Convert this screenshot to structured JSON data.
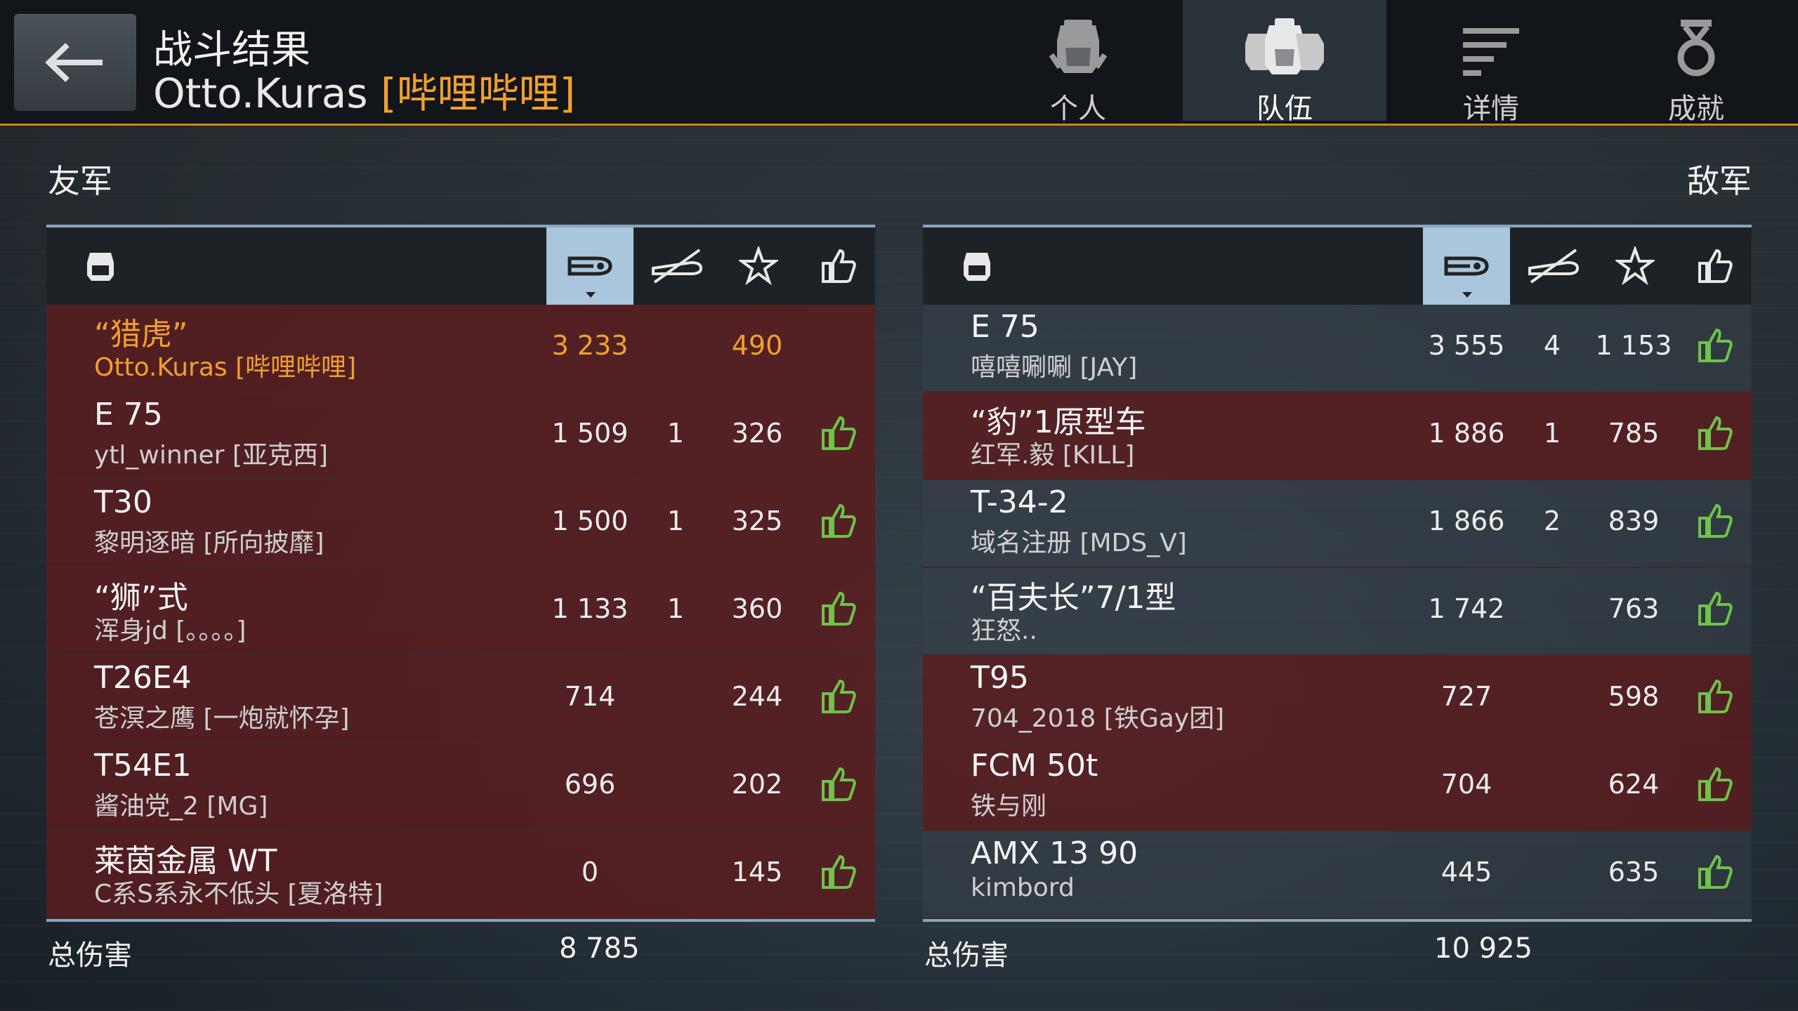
{
  "header": {
    "title": "战斗结果",
    "player_name": "Otto.Kuras",
    "player_clan": "[哔哩哔哩]",
    "tabs": [
      {
        "label": "个人",
        "icon": "tank-crew-icon"
      },
      {
        "label": "队伍",
        "icon": "team-icon"
      },
      {
        "label": "详情",
        "icon": "details-list-icon"
      },
      {
        "label": "成就",
        "icon": "medal-icon"
      }
    ],
    "active_tab": "队伍"
  },
  "allies": {
    "title": "友军",
    "rows": [
      {
        "tank": "“猎虎”",
        "player": "Otto.Kuras [哔哩哔哩]",
        "damage": "3 233",
        "kills": "",
        "xp": "490",
        "liked": false,
        "self": true
      },
      {
        "tank": "E 75",
        "player": "ytl_winner [亚克西]",
        "damage": "1 509",
        "kills": "1",
        "xp": "326",
        "liked": true
      },
      {
        "tank": "T30",
        "player": "黎明逐暗 [所向披靡]",
        "damage": "1 500",
        "kills": "1",
        "xp": "325",
        "liked": true
      },
      {
        "tank": "“狮”式",
        "player": "浑身jd [。。。。]",
        "damage": "1 133",
        "kills": "1",
        "xp": "360",
        "liked": true
      },
      {
        "tank": "T26E4",
        "player": "苍溟之鹰 [一炮就怀孕]",
        "damage": "714",
        "kills": "",
        "xp": "244",
        "liked": true
      },
      {
        "tank": "T54E1",
        "player": "酱油党_2 [MG]",
        "damage": "696",
        "kills": "",
        "xp": "202",
        "liked": true
      },
      {
        "tank": "莱茵金属 WT",
        "player": "C系S系永不低头 [夏洛特]",
        "damage": "0",
        "kills": "",
        "xp": "145",
        "liked": true
      }
    ],
    "total_label": "总伤害",
    "total_damage": "8 785"
  },
  "enemies": {
    "title": "敌军",
    "rows": [
      {
        "tank": "E 75",
        "player": "嘻嘻唰唰 [JAY]",
        "damage": "3 555",
        "kills": "4",
        "xp": "1 153",
        "liked": true,
        "gray": true
      },
      {
        "tank": "“豹”1原型车",
        "player": "红军.毅 [KILL]",
        "damage": "1 886",
        "kills": "1",
        "xp": "785",
        "liked": true
      },
      {
        "tank": "T-34-2",
        "player": "域名注册 [MDS_V]",
        "damage": "1 866",
        "kills": "2",
        "xp": "839",
        "liked": true,
        "gray": true
      },
      {
        "tank": "“百夫长”7/1型",
        "player": "狂怒..",
        "damage": "1 742",
        "kills": "",
        "xp": "763",
        "liked": true,
        "gray": true
      },
      {
        "tank": "T95",
        "player": "704_2018 [铁Gay团]",
        "damage": "727",
        "kills": "",
        "xp": "598",
        "liked": true
      },
      {
        "tank": "FCM 50t",
        "player": "铁与刚",
        "damage": "704",
        "kills": "",
        "xp": "624",
        "liked": true
      },
      {
        "tank": "AMX 13 90",
        "player": "kimbord",
        "damage": "445",
        "kills": "",
        "xp": "635",
        "liked": true,
        "gray": true
      }
    ],
    "total_label": "总伤害",
    "total_damage": "10 925"
  },
  "colors": {
    "accent_orange": "#f0a030",
    "row_red": "#5c1c1e",
    "sel_header": "#a9c6dd",
    "like_green": "#6fc24a"
  },
  "column_icons": [
    "tank-icon",
    "damage-shell-icon",
    "destroyed-tank-icon",
    "star-icon",
    "thumbs-up-icon"
  ]
}
